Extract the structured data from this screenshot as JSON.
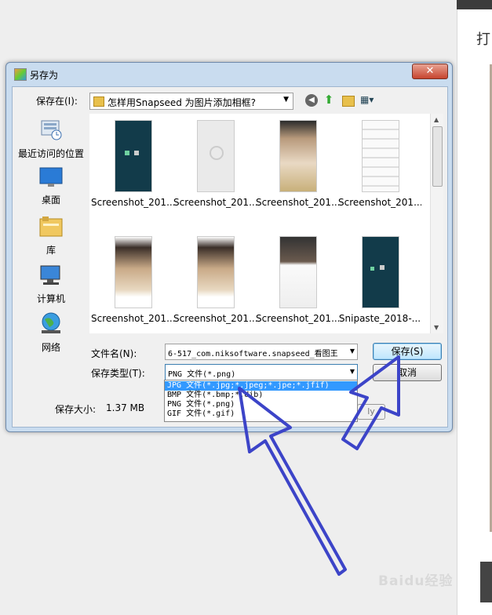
{
  "background": {
    "side_char": "打"
  },
  "dialog": {
    "title": "另存为",
    "close_label": "✕",
    "save_in_label": "保存在(I):",
    "current_folder": "怎样用Snapseed 为图片添加相框?",
    "places": [
      {
        "label": "最近访问的位置"
      },
      {
        "label": "桌面"
      },
      {
        "label": "库"
      },
      {
        "label": "计算机"
      },
      {
        "label": "网络"
      }
    ],
    "files": [
      {
        "name": "Screenshot_201..."
      },
      {
        "name": "Screenshot_201..."
      },
      {
        "name": "Screenshot_201..."
      },
      {
        "name": "Screenshot_201..."
      },
      {
        "name": "Screenshot_201..."
      },
      {
        "name": "Screenshot_201..."
      },
      {
        "name": "Screenshot_201..."
      },
      {
        "name": "Snipaste_2018-..."
      }
    ],
    "filename_label": "文件名(N):",
    "filename_value": "6-517_com.niksoftware.snapseed_看图王",
    "filetype_label": "保存类型(T):",
    "filetype_value": "PNG 文件(*.png)",
    "filetype_options": [
      "JPG 文件(*.jpg;*.jpeg;*.jpe;*.jfif)",
      "BMP 文件(*.bmp;*.dib)",
      "PNG 文件(*.png)",
      "GIF 文件(*.gif)"
    ],
    "save_button": "保存(S)",
    "cancel_button": "取消",
    "size_label": "保存大小:",
    "size_value": "1.37 MB"
  },
  "watermark": "Baidu经验",
  "colors": {
    "accent_arrow": "#3c44c8",
    "selection": "#3399ff"
  }
}
